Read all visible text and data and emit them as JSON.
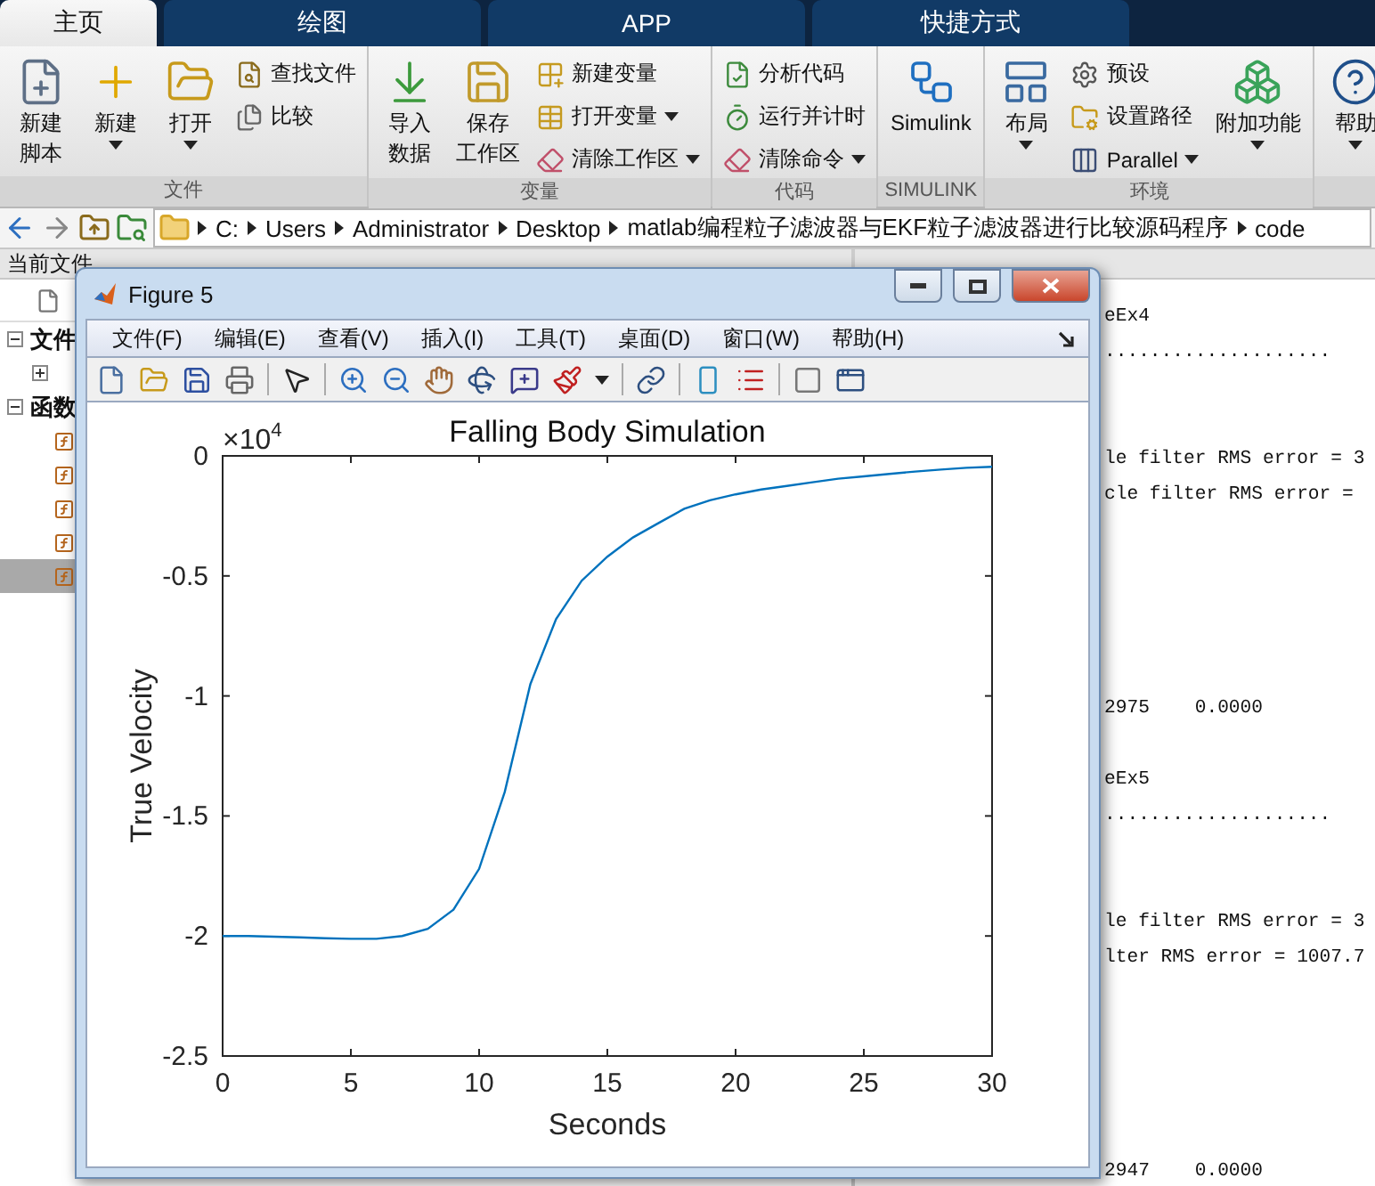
{
  "ribbon_tabs": [
    {
      "label": "主页",
      "selected": true
    },
    {
      "label": "绘图",
      "selected": false
    },
    {
      "label": "APP",
      "selected": false
    },
    {
      "label": "快捷方式",
      "selected": false
    }
  ],
  "ribbon_groups": [
    {
      "title": "文件",
      "items": [
        {
          "kind": "large",
          "lines": [
            "新建",
            "脚本"
          ],
          "dropdown": false
        },
        {
          "kind": "large",
          "lines": [
            "新建"
          ],
          "dropdown": true
        },
        {
          "kind": "large",
          "lines": [
            "打开"
          ],
          "dropdown": true
        },
        {
          "kind": "stack",
          "items": [
            {
              "label": "查找文件",
              "dropdown": false
            },
            {
              "label": "比较",
              "dropdown": false
            }
          ]
        }
      ]
    },
    {
      "title": "变量",
      "items": [
        {
          "kind": "large",
          "lines": [
            "导入",
            "数据"
          ],
          "dropdown": false
        },
        {
          "kind": "large",
          "lines": [
            "保存",
            "工作区"
          ],
          "dropdown": false
        },
        {
          "kind": "stack",
          "items": [
            {
              "label": "新建变量",
              "dropdown": false
            },
            {
              "label": "打开变量",
              "dropdown": true
            },
            {
              "label": "清除工作区",
              "dropdown": true
            }
          ]
        }
      ]
    },
    {
      "title": "代码",
      "items": [
        {
          "kind": "stack",
          "items": [
            {
              "label": "分析代码",
              "dropdown": false
            },
            {
              "label": "运行并计时",
              "dropdown": false
            },
            {
              "label": "清除命令",
              "dropdown": true
            }
          ]
        }
      ]
    },
    {
      "title": "SIMULINK",
      "items": [
        {
          "kind": "large",
          "lines": [
            "Simulink"
          ],
          "dropdown": false
        }
      ]
    },
    {
      "title": "环境",
      "items": [
        {
          "kind": "large",
          "lines": [
            "布局"
          ],
          "dropdown": true
        },
        {
          "kind": "stack",
          "items": [
            {
              "label": "预设",
              "dropdown": false
            },
            {
              "label": "设置路径",
              "dropdown": false
            },
            {
              "label": "Parallel",
              "dropdown": true
            }
          ]
        },
        {
          "kind": "large",
          "lines": [
            "附加功能"
          ],
          "dropdown": true
        }
      ]
    },
    {
      "items": [
        {
          "kind": "large",
          "lines": [
            "帮助"
          ],
          "dropdown": true
        }
      ]
    }
  ],
  "address_path": [
    "C:",
    "Users",
    "Administrator",
    "Desktop",
    "matlab编程粒子滤波器与EKF粒子滤波器进行比较源码程序",
    "code"
  ],
  "file_panel": {
    "header": "当前文件",
    "tree": [
      {
        "label": "文件",
        "expanded": true,
        "children": [
          {
            "expanded": false
          }
        ]
      },
      {
        "label": "函数",
        "expanded": true,
        "children": [
          {
            "selected": false
          },
          {
            "selected": false
          },
          {
            "selected": false
          },
          {
            "selected": false
          },
          {
            "selected": true
          }
        ]
      }
    ]
  },
  "command_window": {
    "lines": [
      {
        "kind": "text",
        "text": "eEx4"
      },
      {
        "kind": "text",
        "text": "...................."
      },
      {
        "kind": "blank"
      },
      {
        "kind": "blank"
      },
      {
        "kind": "text",
        "text": "le filter RMS error = 3"
      },
      {
        "kind": "text",
        "text": "cle filter RMS error ="
      },
      {
        "kind": "blank"
      },
      {
        "kind": "blank"
      },
      {
        "kind": "blank"
      },
      {
        "kind": "blank"
      },
      {
        "kind": "blank"
      },
      {
        "kind": "text",
        "text": "2975    0.0000"
      },
      {
        "kind": "blank"
      },
      {
        "kind": "text",
        "text": "eEx5"
      },
      {
        "kind": "text",
        "text": "...................."
      },
      {
        "kind": "blank"
      },
      {
        "kind": "blank"
      },
      {
        "kind": "text",
        "text": "le filter RMS error = 3"
      },
      {
        "kind": "text",
        "text": "lter RMS error = 1007.7"
      },
      {
        "kind": "blank"
      },
      {
        "kind": "blank"
      },
      {
        "kind": "blank"
      },
      {
        "kind": "blank"
      },
      {
        "kind": "blank"
      },
      {
        "kind": "text",
        "text": "2947    0.0000"
      }
    ]
  },
  "figure": {
    "title": "Figure 5",
    "menu": [
      "文件(F)",
      "编辑(E)",
      "查看(V)",
      "插入(I)",
      "工具(T)",
      "桌面(D)",
      "窗口(W)",
      "帮助(H)"
    ],
    "y_multiplier": {
      "base": "×10",
      "power": "4"
    },
    "chart_data": {
      "type": "line",
      "title": "Falling Body Simulation",
      "xlabel": "Seconds",
      "ylabel": "True Velocity",
      "x": [
        0,
        1,
        2,
        3,
        4,
        5,
        6,
        7,
        8,
        9,
        10,
        11,
        12,
        13,
        14,
        15,
        16,
        17,
        18,
        19,
        20,
        21,
        22,
        23,
        24,
        25,
        26,
        27,
        28,
        29,
        30
      ],
      "series": [
        {
          "color": "#0072bd",
          "values": [
            -2.0,
            -2.0,
            -2.003,
            -2.006,
            -2.01,
            -2.012,
            -2.012,
            -2.0,
            -1.97,
            -1.89,
            -1.72,
            -1.4,
            -0.95,
            -0.68,
            -0.52,
            -0.42,
            -0.34,
            -0.28,
            -0.22,
            -0.185,
            -0.16,
            -0.14,
            -0.125,
            -0.11,
            -0.095,
            -0.085,
            -0.075,
            -0.065,
            -0.057,
            -0.05,
            -0.045
          ]
        }
      ],
      "xlim": [
        0,
        30
      ],
      "ylim": [
        -2.5,
        0
      ],
      "xticks": [
        0,
        5,
        10,
        15,
        20,
        25,
        30
      ],
      "yticks": [
        -2.5,
        -2,
        -1.5,
        -1,
        -0.5,
        0
      ]
    }
  }
}
